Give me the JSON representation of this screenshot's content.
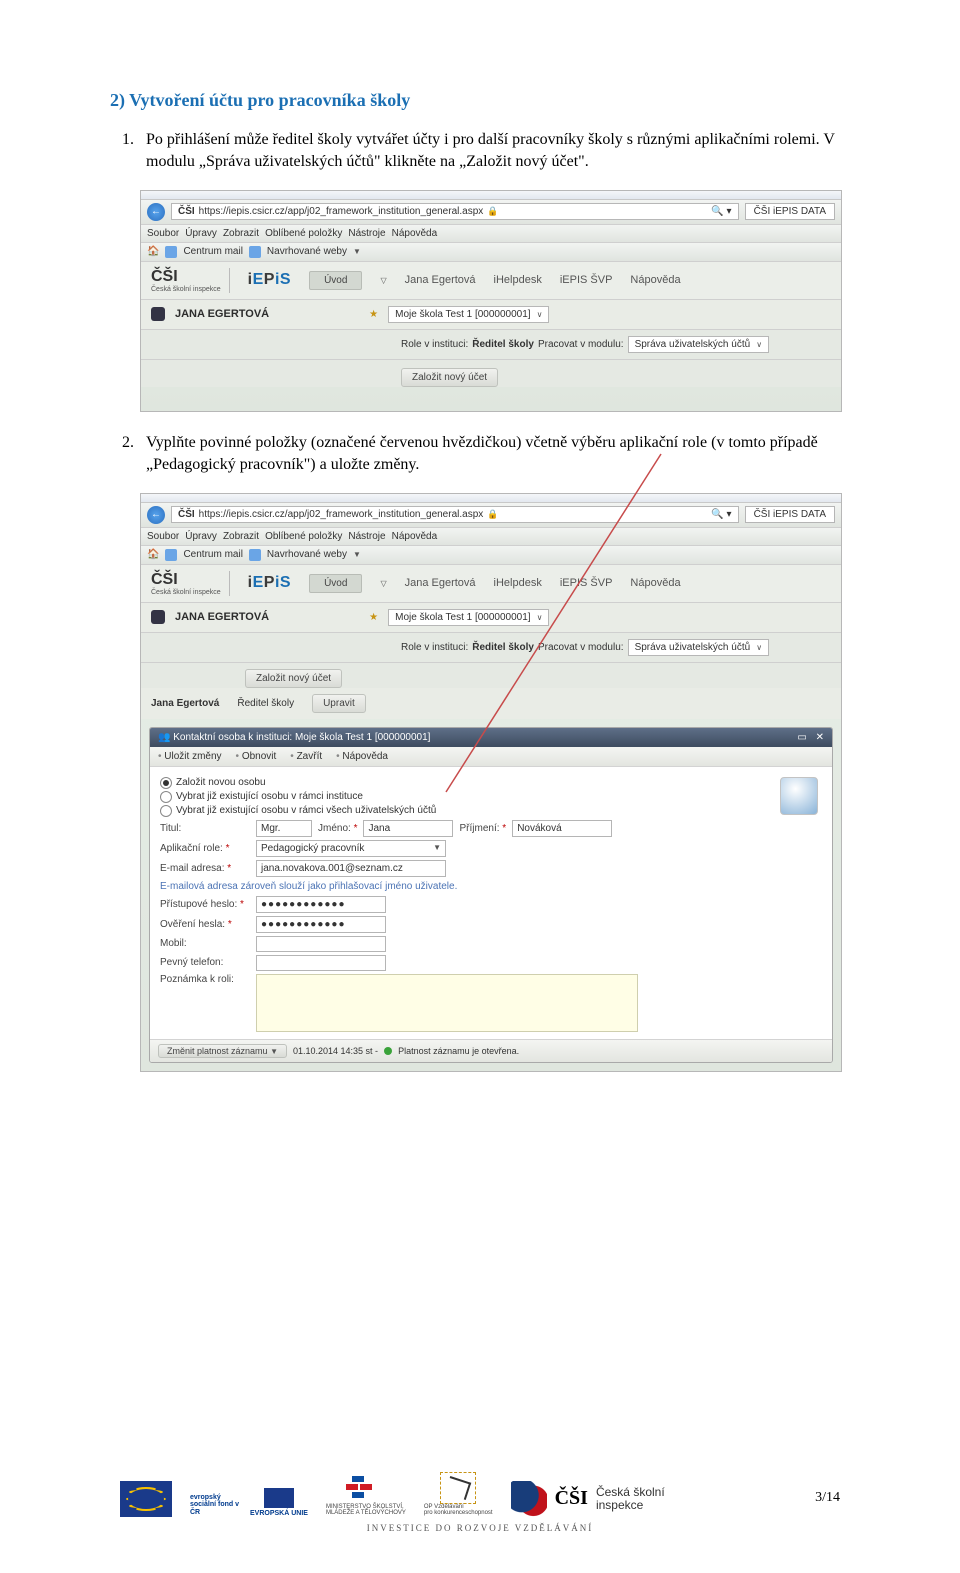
{
  "section_heading": "2) Vytvoření účtu pro pracovníka školy",
  "step1": {
    "num": "1",
    "text": "Po přihlášení může ředitel školy vytvářet účty i pro další pracovníky školy s různými aplikačními rolemi. V modulu „Správa uživatelských účtů\" klikněte na „Založit nový účet\"."
  },
  "step2": {
    "num": "2",
    "text": "Vyplňte povinné položky (označené červenou hvězdičkou) včetně výběru aplikační role (v tomto případě „Pedagogický pracovník\") a uložte změny."
  },
  "shot1": {
    "url": "https://iepis.csicr.cz/app/j02_framework_institution_general.aspx",
    "tab": "ČŠI iEPIS DATA",
    "menus": [
      "Soubor",
      "Úpravy",
      "Zobrazit",
      "Oblíbené položky",
      "Nástroje",
      "Nápověda"
    ],
    "fav1": "Centrum mail",
    "fav2": "Navrhované weby",
    "csi_small": "Česká školní\ninspekce",
    "header_links": [
      "Úvod",
      "Jana Egertová",
      "iHelpdesk",
      "iEPIS ŠVP",
      "Nápověda"
    ],
    "username": "JANA EGERTOVÁ",
    "school": "Moje škola Test 1 [000000001]",
    "role_label": "Role v instituci:",
    "role_value": "Ředitel školy",
    "module_label": "Pracovat v modulu:",
    "module_value": "Správa uživatelských účtů",
    "new_btn": "Založit nový účet"
  },
  "shot2": {
    "url": "https://iepis.csicr.cz/app/j02_framework_institution_general.aspx",
    "tab": "ČŠI iEPIS DATA",
    "menus": [
      "Soubor",
      "Úpravy",
      "Zobrazit",
      "Oblíbené položky",
      "Nástroje",
      "Nápověda"
    ],
    "fav1": "Centrum mail",
    "fav2": "Navrhované weby",
    "csi_small": "Česká školní\ninspekce",
    "header_links": [
      "Úvod",
      "Jana Egertová",
      "iHelpdesk",
      "iEPIS ŠVP",
      "Nápověda"
    ],
    "username": "JANA EGERTOVÁ",
    "school": "Moje škola Test 1 [000000001]",
    "role_label": "Role v instituci:",
    "role_value": "Ředitel školy",
    "module_label": "Pracovat v modulu:",
    "module_value": "Správa uživatelských účtů",
    "new_btn": "Založit nový účet",
    "user_name": "Jana Egertová",
    "user_role": "Ředitel školy",
    "edit_btn": "Upravit",
    "panel_title": "Kontaktní osoba k instituci: Moje škola Test 1 [000000001]",
    "toolbar": [
      "Uložit změny",
      "Obnovit",
      "Zavřít",
      "Nápověda"
    ],
    "radios": [
      "Založit novou osobu",
      "Vybrat již existující osobu v rámci instituce",
      "Vybrat již existující osobu v rámci všech uživatelských účtů"
    ],
    "labels": {
      "titul": "Titul:",
      "titul_val": "Mgr.",
      "jmeno": "Jméno:",
      "jmeno_val": "Jana",
      "prijmeni": "Příjmení:",
      "prijmeni_val": "Nováková",
      "aprole": "Aplikační role:",
      "aprole_val": "Pedagogický pracovník",
      "email": "E-mail adresa:",
      "email_val": "jana.novakova.001@seznam.cz",
      "hint": "E-mailová adresa zároveň slouží jako přihlašovací jméno uživatele.",
      "heslo": "Přístupové heslo:",
      "heslo_val": "●●●●●●●●●●●●",
      "overeni": "Ověření hesla:",
      "overeni_val": "●●●●●●●●●●●●",
      "mobil": "Mobil:",
      "pevny": "Pevný telefon:",
      "pozn": "Poznámka k roli:",
      "req": "*"
    },
    "status_label": "Změnit platnost záznamu",
    "status_date": "01.10.2014 14:35 st -",
    "status_text": "Platnost záznamu je otevřena."
  },
  "footer": {
    "esf": "evropský\nsociální\nfond v ČR",
    "eu": "EVROPSKÁ UNIE",
    "msmt": "MINISTERSTVO ŠKOLSTVÍ,\nMLÁDEŽE A TĚLOVÝCHOVY",
    "opvk": "OP Vzdělávání\npro konkurenceschopnost",
    "csi": "Česká školní\ninspekce",
    "invest": "INVESTICE DO ROZVOJE VZDĚLÁVÁNÍ",
    "page": "3/14"
  }
}
